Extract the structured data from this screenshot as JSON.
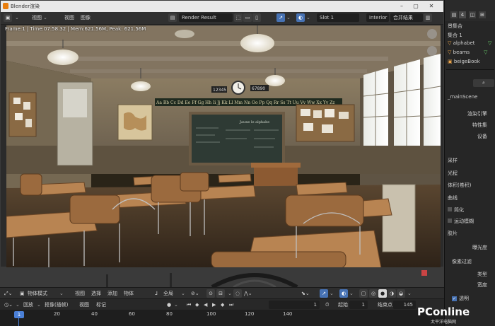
{
  "window": {
    "title": "Blender渲染"
  },
  "toolbar": {
    "view": "视图",
    "view2": "视图",
    "image": "图像",
    "image_name": "Render Result",
    "slot": "Slot 1",
    "layer": "interior",
    "pass": "合并结果"
  },
  "status": {
    "text": "Frame:1 | Time:07:58.32 | Mem:621.56M, Peak: 621.56M"
  },
  "scene": {
    "clock_left": "12345",
    "clock_right": "67890",
    "alphabet": "Aa Bb Cc Dd Ee Ff Gg Hh Ii Jj Kk Ll Mm Nn Oo Pp Qq Rr Ss Tt Uu Vv Ww Xx Yy Zz",
    "board_text": "Jaune le alphabe"
  },
  "right_panel": {
    "tab_num": "4",
    "scene_collection": "景集合",
    "collection1": "集合 1",
    "items": [
      "alphabet",
      "beams",
      "beigeBook"
    ],
    "main_scene": "_mainScene",
    "render_engine": "渲染引擎",
    "feature_set": "特性集",
    "device": "设备",
    "sampling": "采样",
    "light_paths": "光程",
    "volumes": "体积(卷积)",
    "curves": "曲线",
    "simplify": "简化",
    "motion_blur": "运动模糊",
    "film": "胶片",
    "exposure": "曝光度",
    "pixel_filter": "像素过滤",
    "type": "类型",
    "width": "宽度",
    "transparent": "透明"
  },
  "viewport_header": {
    "mode": "物体模式",
    "view": "视图",
    "select": "选择",
    "add": "添加",
    "object": "物体",
    "pivot": "全局"
  },
  "timeline_header": {
    "playback": "回放",
    "keying": "抠像(插帧)",
    "view": "视图",
    "marker": "标记",
    "current_frame": "1",
    "start_label": "起始",
    "start": "1",
    "end_label": "结束点",
    "end": "145"
  },
  "timeline": {
    "ticks": [
      "1",
      "20",
      "40",
      "60",
      "80",
      "100",
      "120",
      "140"
    ]
  },
  "watermark": {
    "text": "PConline",
    "sub": "太平洋电脑网"
  },
  "colors": {
    "accent": "#4772b3",
    "play_marker": "#4a7fd6"
  }
}
